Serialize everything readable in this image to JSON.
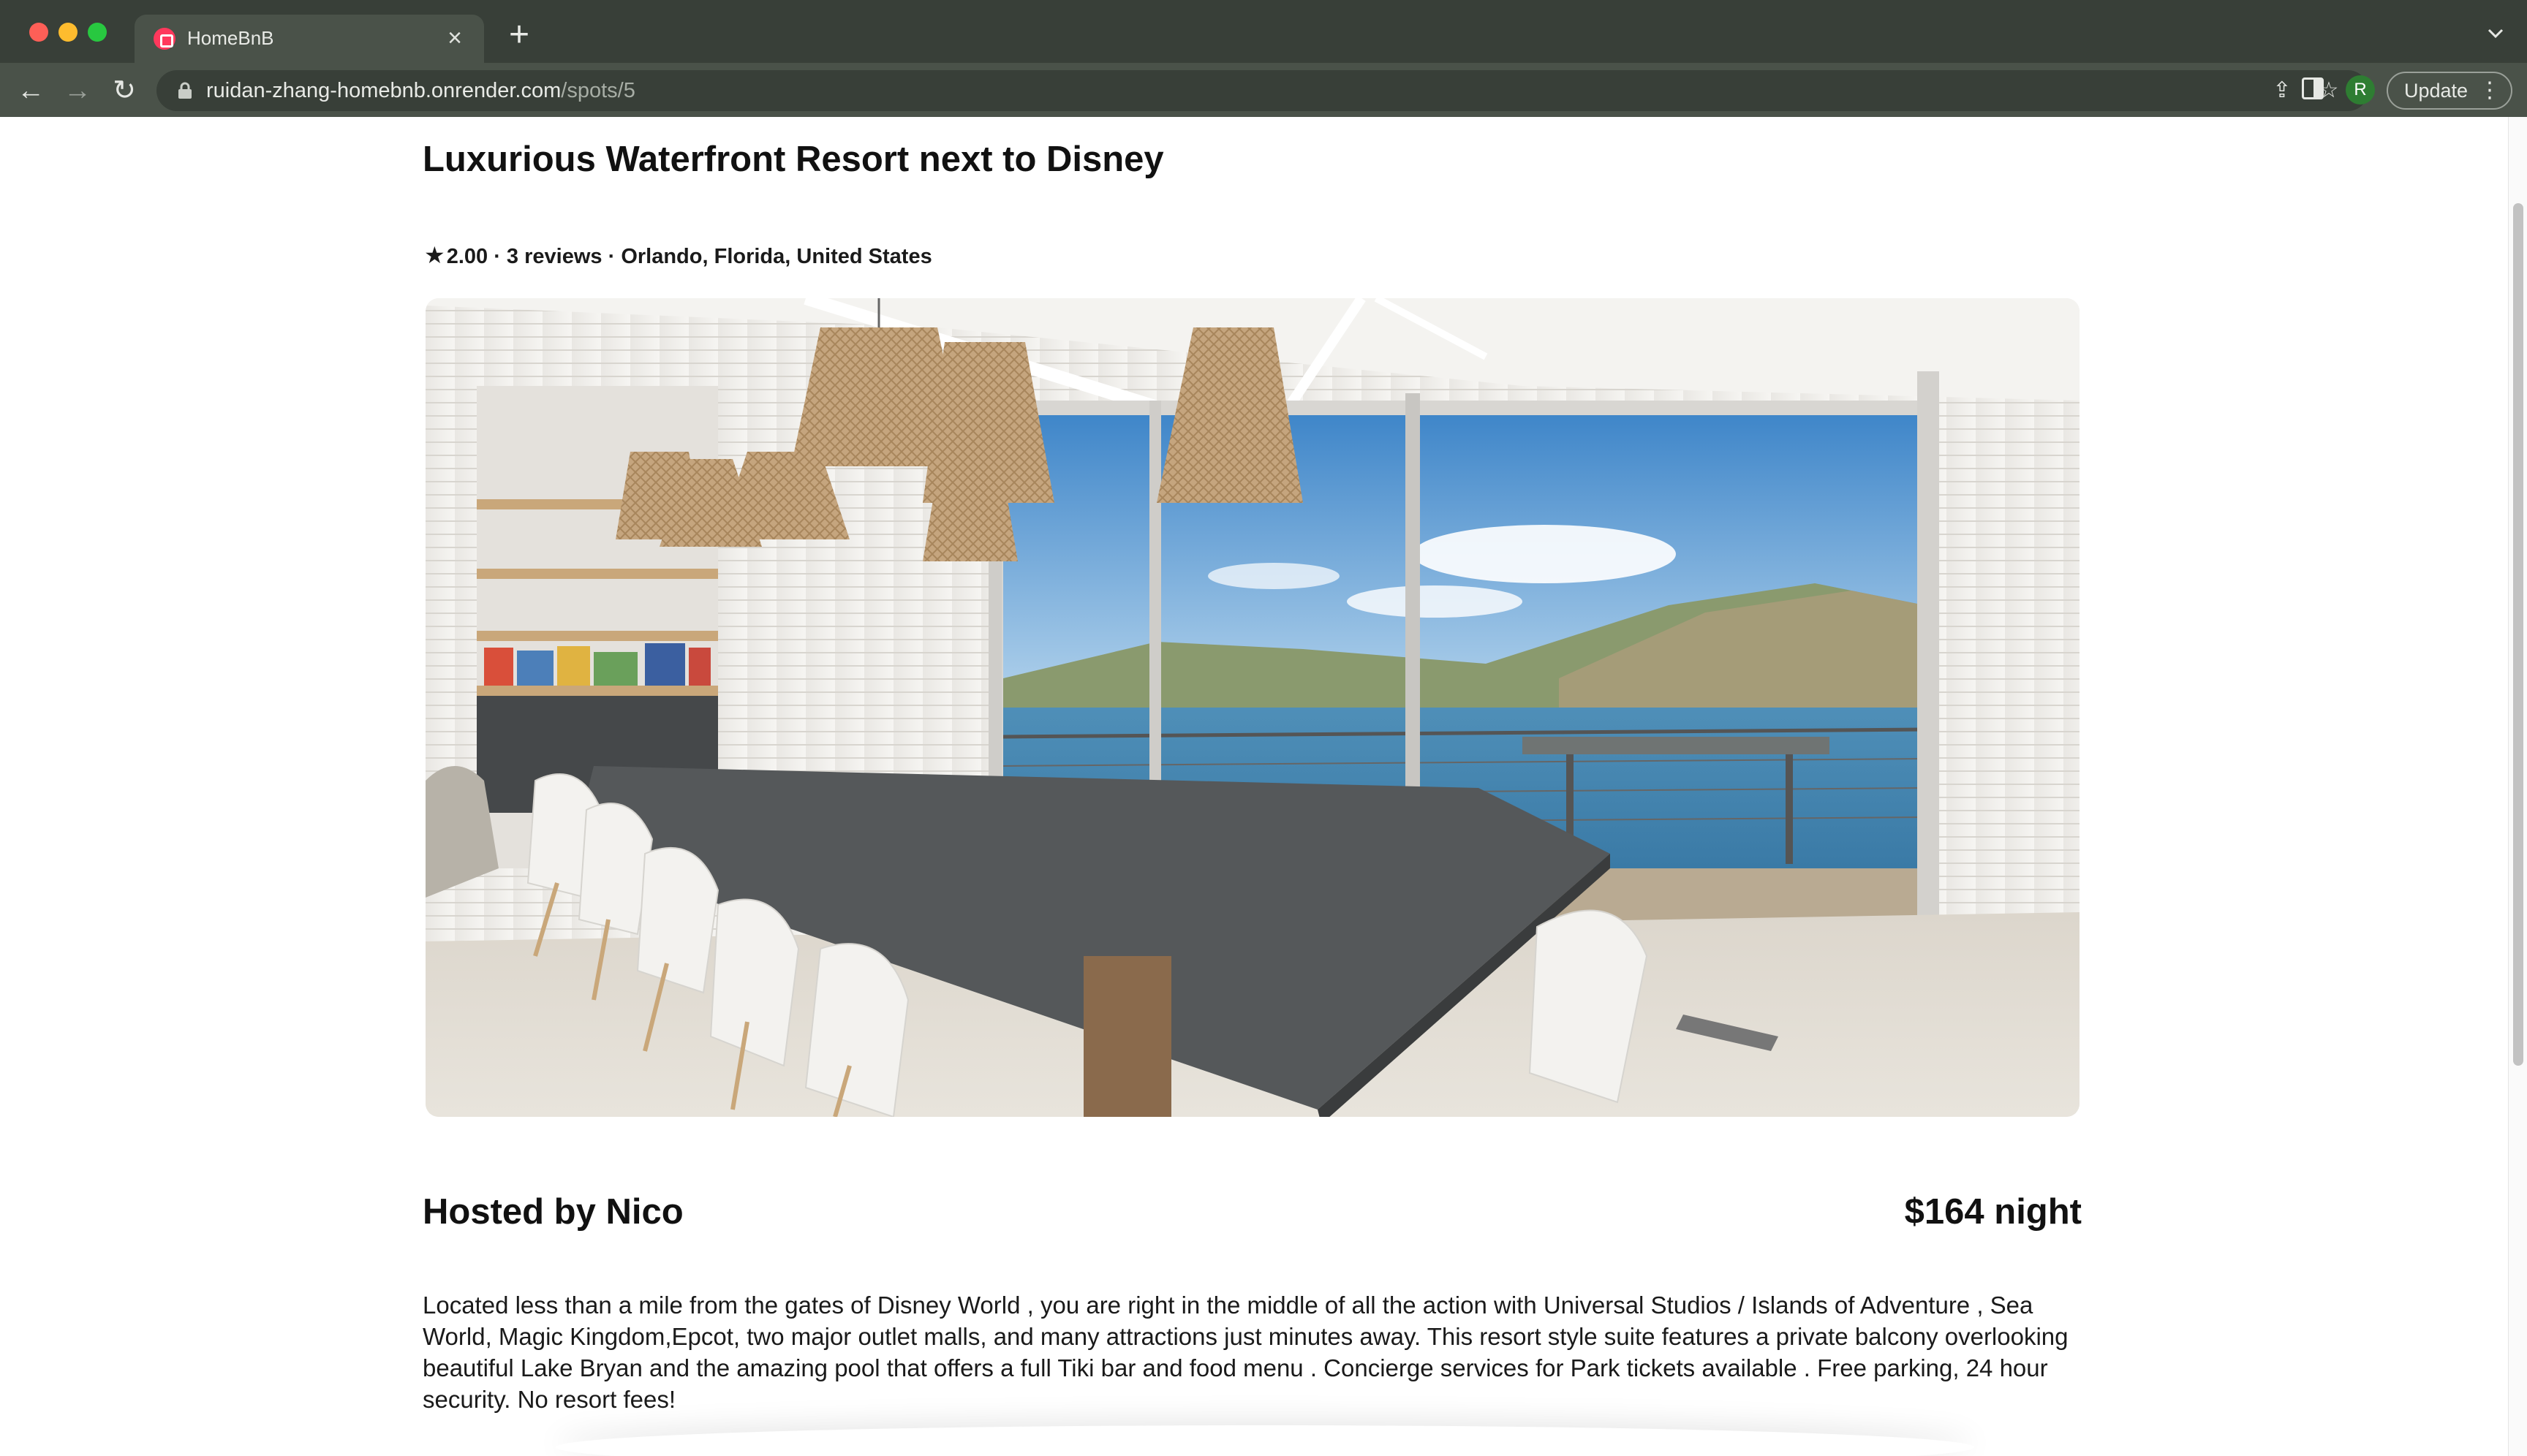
{
  "browser": {
    "tab_title": "HomeBnB",
    "url_host": "ruidan-zhang-homebnb.onrender.com",
    "url_path": "/spots/5",
    "avatar_initial": "R",
    "update_label": "Update",
    "accent_tab_icon": "#ff385c"
  },
  "spot": {
    "title": "Luxurious Waterfront Resort next to Disney",
    "rating": "2.00",
    "reviews": "3 reviews",
    "location": "Orlando, Florida, United States",
    "host": "Hosted by Nico",
    "price": "$164 night",
    "description": "Located less than a mile from the gates of Disney World , you are right in the middle of all the action with Universal Studios / Islands of Adventure , Sea World, Magic Kingdom,Epcot, two major outlet malls, and many attractions just minutes away. This resort style suite features a private balcony overlooking beautiful Lake Bryan and the amazing pool that offers a full Tiki bar and food menu . Concierge services for Park tickets available . Free parking, 24 hour security. No resort fees!",
    "image": "dining-room-with-lake-view"
  },
  "separator": " · "
}
